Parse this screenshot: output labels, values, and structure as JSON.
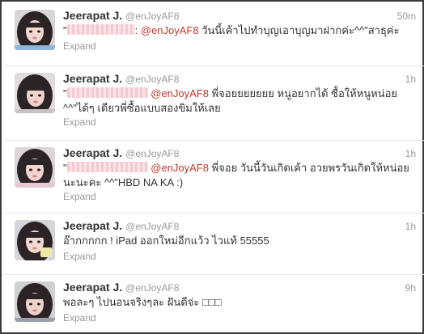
{
  "tweets": [
    {
      "name": "Jeerapat J.",
      "handle": "@enJoyAF8",
      "time": "50m",
      "quote_open": "\"",
      "redacted_suffix": ":",
      "mention": "@enJoyAF8",
      "body": " วันนี้เค้าไปทำบุญเอาบุญมาฝากค่ะ^^\"สาธุค่ะ",
      "body_line2": "",
      "expand": "Expand"
    },
    {
      "name": "Jeerapat J.",
      "handle": "@enJoyAF8",
      "time": "1h",
      "quote_open": "\"",
      "redacted_suffix": "",
      "mention": "@enJoyAF8",
      "body": " พี่จอยยยยยยย หนูอยากได้ ซื้อให้หนูหน่อย",
      "body_line2": "^^\"ได้ๆ เดียวพี่ซื้อแบบสองขิมให้เลย",
      "expand": "Expand"
    },
    {
      "name": "Jeerapat J.",
      "handle": "@enJoyAF8",
      "time": "1h",
      "quote_open": "\"",
      "redacted_suffix": "",
      "mention": "@enJoyAF8",
      "body": " พี่จอย วันนี้วันเกิดเค้า อวยพรวันเกิดให้หน่อย",
      "body_line2": "นะนะคะ ^^\"HBD NA KA :)",
      "expand": "Expand"
    },
    {
      "name": "Jeerapat J.",
      "handle": "@enJoyAF8",
      "time": "1h",
      "text": "อ๊ากกกกก ! iPad ออกใหม่อีกแว้ว ไวแท้ 55555",
      "expand": "Expand"
    },
    {
      "name": "Jeerapat J.",
      "handle": "@enJoyAF8",
      "time": "9h",
      "text": "พอละๆ ไปนอนจริงๆละ ฝันดีจ่ะ □□□",
      "expand": "Expand"
    }
  ]
}
